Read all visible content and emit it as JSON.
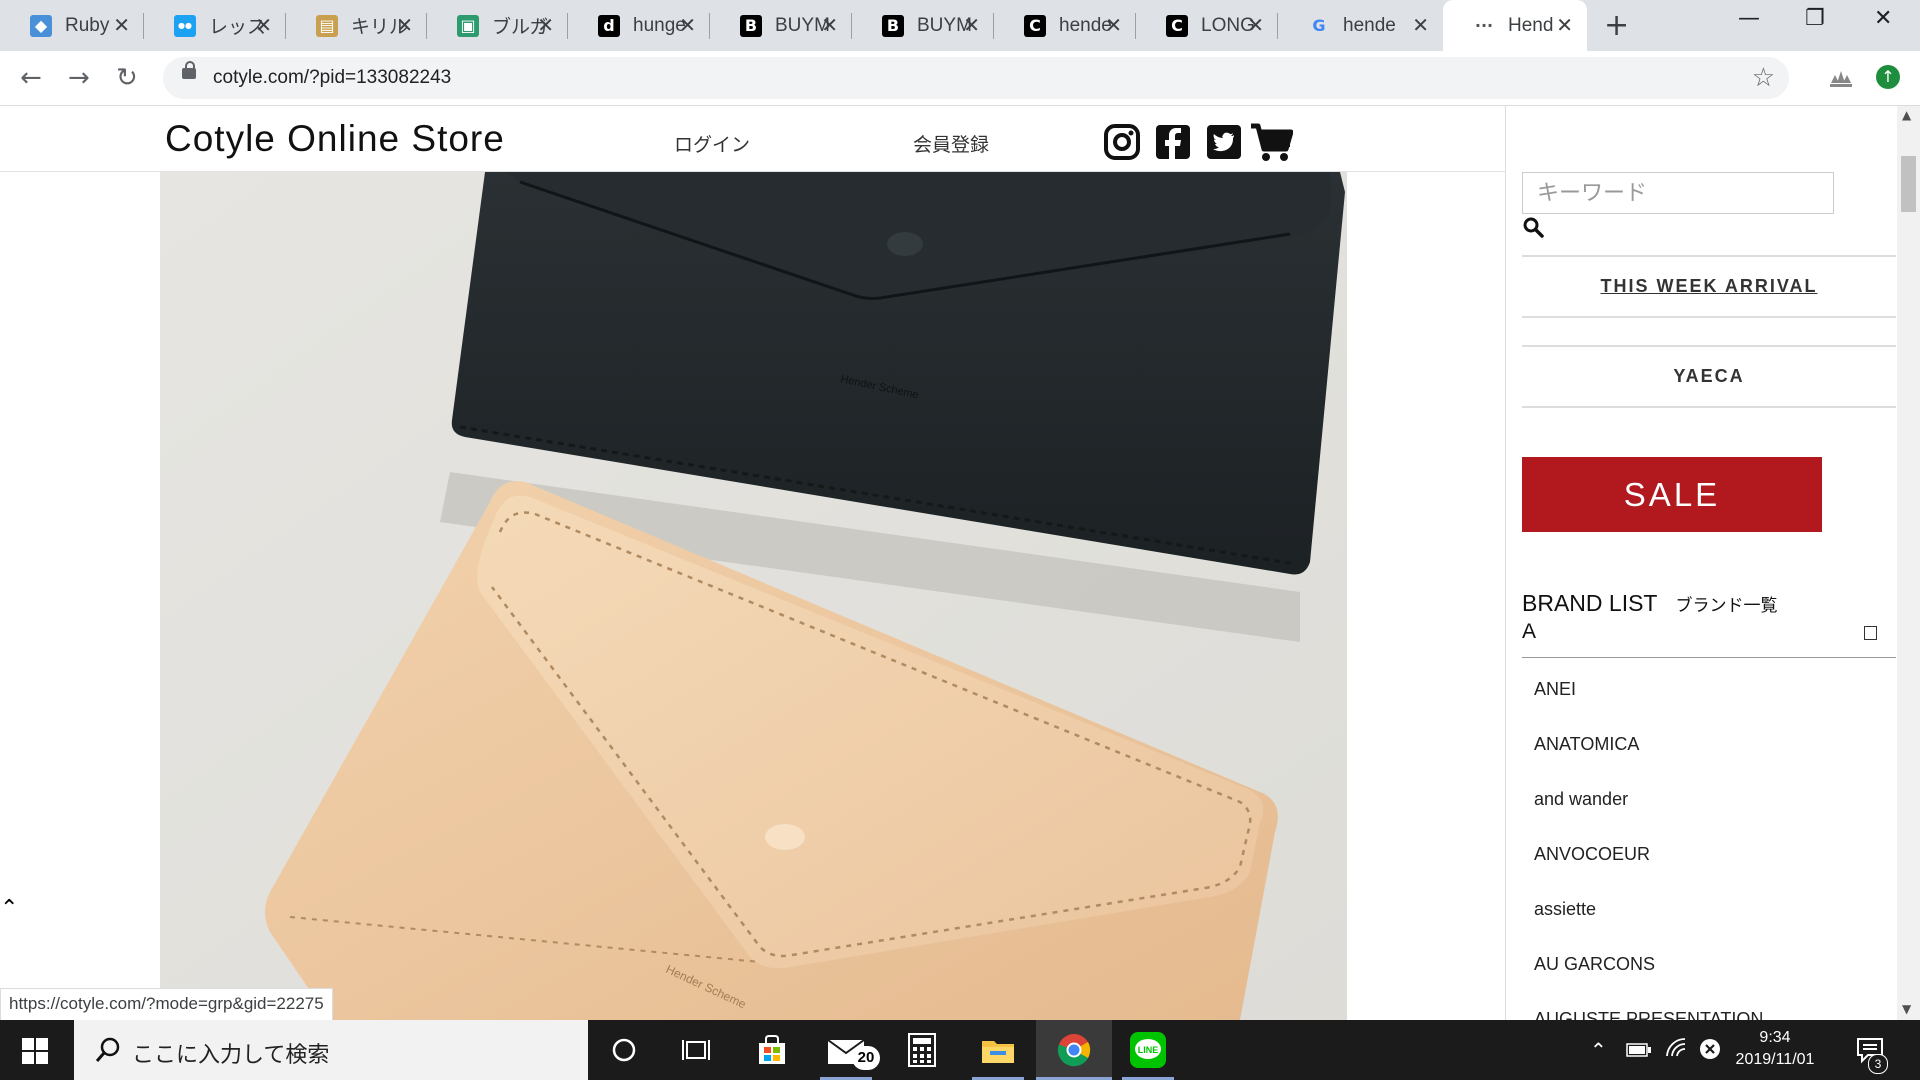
{
  "browser": {
    "tabs": [
      {
        "title": "Ruby",
        "favicon": "gem-icon",
        "color": "#4a90d9"
      },
      {
        "title": "レッスン",
        "favicon": "speech-icon",
        "color": "#1da1f2"
      },
      {
        "title": "キリル文",
        "favicon": "book-icon",
        "color": "#c8a050"
      },
      {
        "title": "ブルガ",
        "favicon": "chat-icon",
        "color": "#2d9b6e"
      },
      {
        "title": "hunge",
        "favicon": "d-letter-icon",
        "color": "#000000"
      },
      {
        "title": "BUYM",
        "favicon": "b-letter-icon",
        "color": "#000000"
      },
      {
        "title": "BUYM",
        "favicon": "b-letter-icon",
        "color": "#000000"
      },
      {
        "title": "hende",
        "favicon": "c-letter-icon",
        "color": "#000000"
      },
      {
        "title": "LONG",
        "favicon": "c-letter-icon",
        "color": "#000000"
      },
      {
        "title": "hende",
        "favicon": "google-icon",
        "color": "#4285f4"
      },
      {
        "title": "Hend",
        "favicon": "dots-icon",
        "color": "#555555",
        "active": true
      }
    ],
    "url": "cotyle.com/?pid=133082243",
    "status_url": "https://cotyle.com/?mode=grp&gid=22275"
  },
  "header": {
    "store_title": "Cotyle Online Store",
    "login": "ログイン",
    "register": "会員登録"
  },
  "sidebar": {
    "search_placeholder": "キーワード",
    "this_week_arrival": "THIS WEEK ARRIVAL",
    "yaeca": "YAECA",
    "sale": "SALE",
    "brand_list_title": "BRAND LIST",
    "brand_list_jp": "ブランド一覧",
    "brand_letter": "A",
    "brands": [
      "ANEI",
      "ANATOMICA",
      "and wander",
      "ANVOCOEUR",
      "assiette",
      "AU GARCONS",
      "AUGUSTE PRESENTATION"
    ]
  },
  "taskbar": {
    "search_text": "ここに入力して検索",
    "mail_badge": "20",
    "time": "9:34",
    "date": "2019/11/01",
    "notification_count": "3"
  },
  "colors": {
    "sale_red": "#b1191f",
    "tabbar": "#dee1e6",
    "taskbar": "#1b1b1b"
  }
}
